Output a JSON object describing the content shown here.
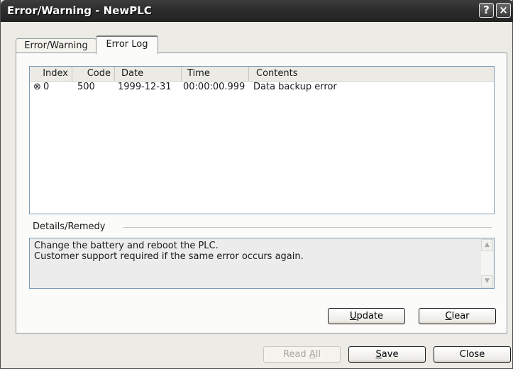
{
  "window": {
    "title": "Error/Warning - NewPLC",
    "help_glyph": "?",
    "close_glyph": "×"
  },
  "tabs": [
    {
      "label": "Error/Warning",
      "active": false
    },
    {
      "label": "Error Log",
      "active": true
    }
  ],
  "log_table": {
    "columns": [
      "Index",
      "Code",
      "Date",
      "Time",
      "Contents"
    ],
    "rows": [
      {
        "icon": "⊗",
        "index": "0",
        "code": "500",
        "date": "1999-12-31",
        "time": "00:00:00.999",
        "contents": "Data backup error"
      }
    ]
  },
  "details": {
    "label": "Details/Remedy",
    "text": "Change the battery and reboot the PLC.\nCustomer support required if the same error occurs again."
  },
  "buttons": {
    "update": {
      "pre": "",
      "key": "U",
      "post": "pdate"
    },
    "clear": {
      "pre": "",
      "key": "C",
      "post": "lear"
    },
    "read_all": {
      "pre": "Read ",
      "key": "A",
      "post": "ll",
      "enabled": false
    },
    "save": {
      "pre": "",
      "key": "S",
      "post": "ave"
    },
    "close": {
      "label": "Close"
    }
  },
  "colors": {
    "titlebar": "#2b2b2b",
    "dialog_bg": "#ecebe6",
    "list_border": "#7f9db9"
  }
}
